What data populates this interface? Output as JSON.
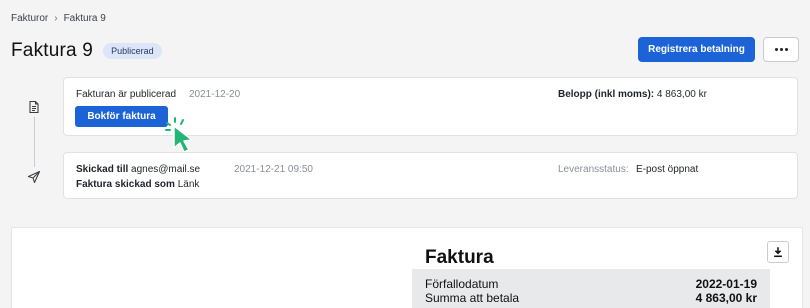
{
  "breadcrumb": {
    "parent": "Fakturor",
    "separator": "›",
    "current": "Faktura 9"
  },
  "header": {
    "title": "Faktura 9",
    "status": "Publicerad",
    "primary_action": "Registrera betalning"
  },
  "timeline": [
    {
      "icon": "document-icon",
      "text": "Fakturan är publicerad",
      "date": "2021-12-20",
      "amount_label": "Belopp (inkl moms):",
      "amount_value": "4 863,00 kr",
      "button": "Bokför faktura"
    },
    {
      "icon": "send-icon",
      "sent_label": "Skickad till",
      "sent_to": "agnes@mail.se",
      "date": "2021-12-21 09:50",
      "sent_as_label": "Faktura skickad som",
      "sent_as_value": "Länk",
      "delivery_label": "Leveransstatus:",
      "delivery_value": "E-post öppnat"
    }
  ],
  "document": {
    "title": "Faktura",
    "rows": [
      {
        "label": "Förfallodatum",
        "value": "2022-01-19"
      },
      {
        "label": "Summa att betala",
        "value": "4 863,00 kr"
      }
    ]
  },
  "colors": {
    "primary": "#1d63d8",
    "badge_bg": "#dde6f8",
    "cursor": "#22b573"
  }
}
